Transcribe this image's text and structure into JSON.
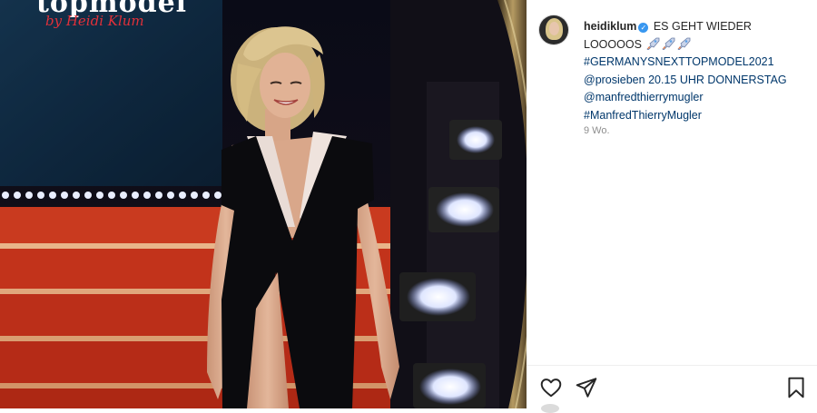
{
  "post": {
    "username": "heidiklum",
    "caption_text": "ES GEHT WIEDER",
    "caption_line2": "LOOOOOS",
    "hashtag_1": "#GERMANYSNEXTTOPMODEL2021",
    "mention_line": "@prosieben 20.15 UHR DONNERSTAG",
    "mention_2": "@manfredthierrymugler",
    "hashtag_2": "#ManfredThierryMugler",
    "age": "9 Wo."
  },
  "photo": {
    "logo_text": "topmodel",
    "logo_sub": "by Heidi Klum"
  },
  "icons": {
    "verified": "verified-badge-icon",
    "rocket": "rocket-emoji-icon",
    "like": "heart-icon",
    "share": "paper-plane-icon",
    "save": "bookmark-icon"
  },
  "colors": {
    "link": "#00376b",
    "muted": "#8e8e8e",
    "verified": "#3897f0",
    "stage_red": "#c8321c"
  }
}
